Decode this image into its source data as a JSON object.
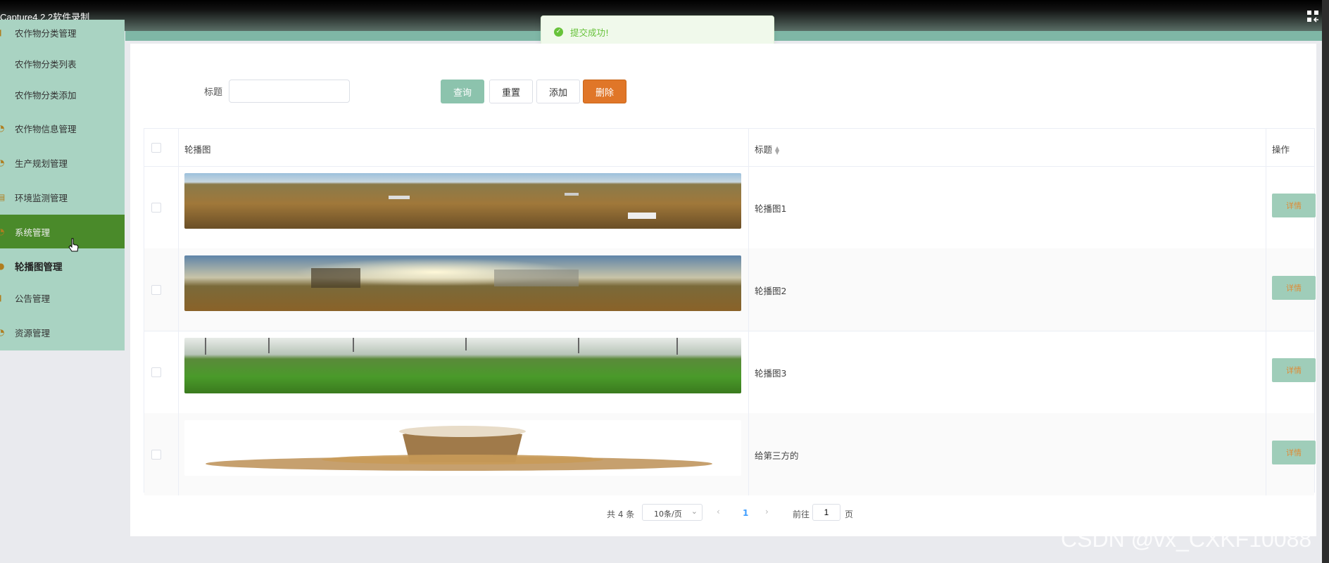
{
  "window": {
    "title": "Capture4.2.2软件录制",
    "fullscreen_icon": "exit-fullscreen-icon"
  },
  "toast": {
    "message": "提交成功!",
    "icon": "check-circle-icon",
    "color": "#67c23a"
  },
  "sidebar": {
    "items": [
      {
        "label": "农作物分类管理",
        "icon": "bar-chart-icon"
      },
      {
        "label": "农作物分类列表"
      },
      {
        "label": "农作物分类添加"
      },
      {
        "label": "农作物信息管理",
        "icon": "clock-icon"
      },
      {
        "label": "生产规划管理",
        "icon": "clock-icon"
      },
      {
        "label": "环境监测管理",
        "icon": "doc-icon"
      },
      {
        "label": "系统管理",
        "icon": "clock-icon",
        "active": true
      },
      {
        "label": "轮播图管理",
        "icon": "pin-icon",
        "bold": true
      },
      {
        "label": "公告管理",
        "icon": "bar-chart-icon"
      },
      {
        "label": "资源管理",
        "icon": "clock-icon"
      }
    ],
    "active_color": "#4a8a2a",
    "bg_color": "#a9d3c2"
  },
  "search": {
    "label": "标题",
    "value": "",
    "placeholder": ""
  },
  "toolbar": {
    "query_label": "查询",
    "reset_label": "重置",
    "add_label": "添加",
    "delete_label": "删除",
    "query_color": "#8cc3ad",
    "delete_color": "#e07628"
  },
  "table": {
    "headers": {
      "image": "轮播图",
      "title": "标题",
      "actions": "操作"
    },
    "rows": [
      {
        "image": "farmland-harvest-image",
        "title": "轮播图1",
        "action": "详情"
      },
      {
        "image": "harvester-sunset-image",
        "title": "轮播图2",
        "action": "详情"
      },
      {
        "image": "greenhouse-vegetables-image",
        "title": "轮播图3",
        "action": "详情"
      },
      {
        "image": "grain-sack-image",
        "title": "给第三方的",
        "action": "详情"
      }
    ]
  },
  "pagination": {
    "total": "共 4 条",
    "page_size": "10条/页",
    "current_page": "1",
    "goto_label": "前往",
    "goto_value": "1",
    "page_suffix": "页"
  },
  "watermark": "CSDN @vx_CXKF10088"
}
